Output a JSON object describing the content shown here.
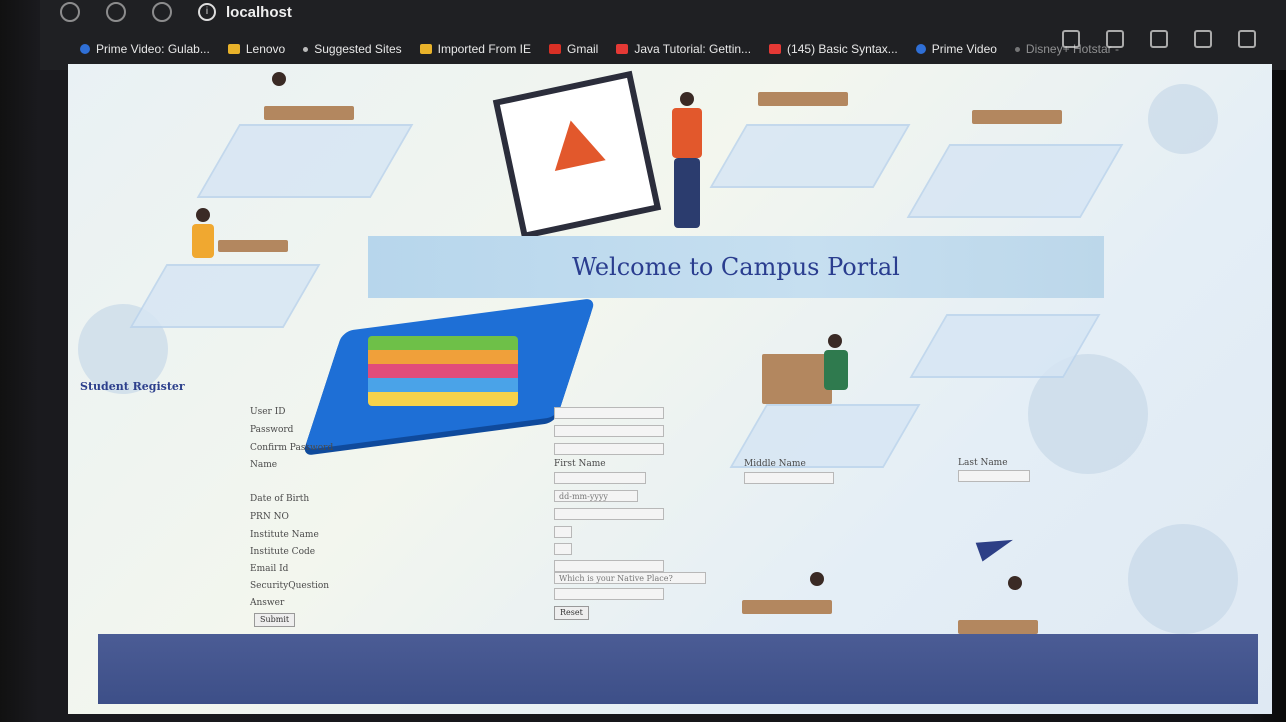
{
  "browser": {
    "address": "localhost",
    "bookmarks": [
      {
        "label": "Prime Video: Gulab...",
        "icon": "prime-video-icon"
      },
      {
        "label": "Lenovo",
        "icon": "folder-icon"
      },
      {
        "label": "Suggested Sites",
        "icon": "dot-icon"
      },
      {
        "label": "Imported From IE",
        "icon": "folder-icon"
      },
      {
        "label": "Gmail",
        "icon": "gmail-icon"
      },
      {
        "label": "Java Tutorial: Gettin...",
        "icon": "youtube-icon"
      },
      {
        "label": "(145) Basic Syntax...",
        "icon": "youtube-icon"
      },
      {
        "label": "Prime Video",
        "icon": "prime-video-icon"
      },
      {
        "label": "Disney+ Hotstar -",
        "icon": "hotstar-icon"
      }
    ]
  },
  "page": {
    "banner_title": "Welcome to Campus Portal",
    "form_title": "Student Register",
    "labels": {
      "user_id": "User ID",
      "password": "Password",
      "confirm_password": "Confirm Password",
      "name": "Name",
      "first_name": "First Name",
      "middle_name": "Middle Name",
      "last_name": "Last Name",
      "dob": "Date of Birth",
      "prn": "PRN NO",
      "institute_name": "Institute Name",
      "institute_code": "Institute Code",
      "email": "Email Id",
      "security_question": "SecurityQuestion",
      "answer": "Answer"
    },
    "dob_placeholder": "dd-mm-yyyy",
    "security_select_value": "Which is your Native Place?",
    "reset_button": "Reset",
    "submit_button": "Submit"
  }
}
